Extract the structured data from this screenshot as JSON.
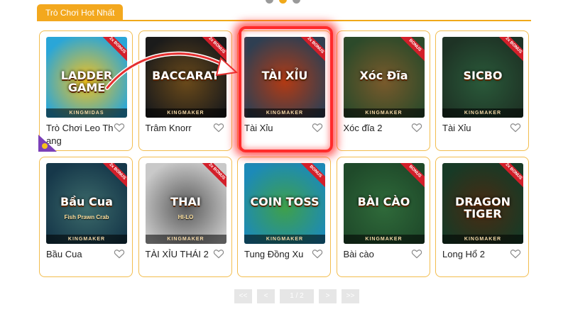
{
  "section": {
    "title": "Trò Chơi Hot Nhất"
  },
  "carousel": {
    "dot_count": 3,
    "active_index": 1
  },
  "games": [
    {
      "name": "Trò Chơi Leo Thang",
      "art_title": "LADDER GAME",
      "art_sub": "",
      "maker": "KINGMIDAS",
      "ribbon": "2x BONUS",
      "bg1": "#2aa6d8",
      "bg2": "#f6c21b"
    },
    {
      "name": "Trâm Knorr",
      "art_title": "BACCARAT",
      "art_sub": "",
      "maker": "KINGMAKER",
      "ribbon": "2x BONUS",
      "bg1": "#1b1b1b",
      "bg2": "#6b4a1a"
    },
    {
      "name": "Tài Xỉu",
      "art_title": "TÀI XỈU",
      "art_sub": "",
      "maker": "KINGMAKER",
      "ribbon": "2x BONUS",
      "bg1": "#2f3f52",
      "bg2": "#b33a13"
    },
    {
      "name": "Xóc đĩa 2",
      "art_title": "Xóc Đĩa",
      "art_sub": "",
      "maker": "KINGMAKER",
      "ribbon": "BONUS",
      "bg1": "#2c4a2a",
      "bg2": "#7a5a2b"
    },
    {
      "name": "Tài Xỉu",
      "art_title": "SICBO",
      "art_sub": "",
      "maker": "KINGMAKER",
      "ribbon": "2x BONUS",
      "bg1": "#1e3325",
      "bg2": "#2a5a3a"
    },
    {
      "name": "Bầu Cua",
      "art_title": "Bầu Cua",
      "art_sub": "Fish Prawn Crab",
      "maker": "KINGMAKER",
      "ribbon": "2x BONUS",
      "bg1": "#16384a",
      "bg2": "#3c6a6a"
    },
    {
      "name": "TÀI XỈU THÁI 2",
      "art_title": "THAI",
      "art_sub": "HI-LO",
      "maker": "KINGMAKER",
      "ribbon": "2x BONUS",
      "bg1": "#c9c9c9",
      "bg2": "#5a5a5a"
    },
    {
      "name": "Tung Đồng Xu",
      "art_title": "COIN TOSS",
      "art_sub": "",
      "maker": "KINGMAKER",
      "ribbon": "BONUS",
      "bg1": "#1c8ab8",
      "bg2": "#3fa04a"
    },
    {
      "name": "Bài cào",
      "art_title": "BÀI CÀO",
      "art_sub": "",
      "maker": "KINGMAKER",
      "ribbon": "BONUS",
      "bg1": "#1f4a2a",
      "bg2": "#2f6a3a"
    },
    {
      "name": "Long Hổ 2",
      "art_title": "DRAGON TIGER",
      "art_sub": "",
      "maker": "KINGMAKER",
      "ribbon": "2x BONUS",
      "bg1": "#173a26",
      "bg2": "#4a2a12"
    }
  ],
  "pagination": {
    "first": "<<",
    "prev": "<",
    "current": "1 / 2",
    "next": ">",
    "last": ">>"
  },
  "colors": {
    "accent": "#f0a91a",
    "card_border": "#f2bd4e",
    "highlight": "#ff2b2b"
  },
  "icons": {
    "favorite": "heart-icon",
    "corner": "star-badge-icon"
  }
}
